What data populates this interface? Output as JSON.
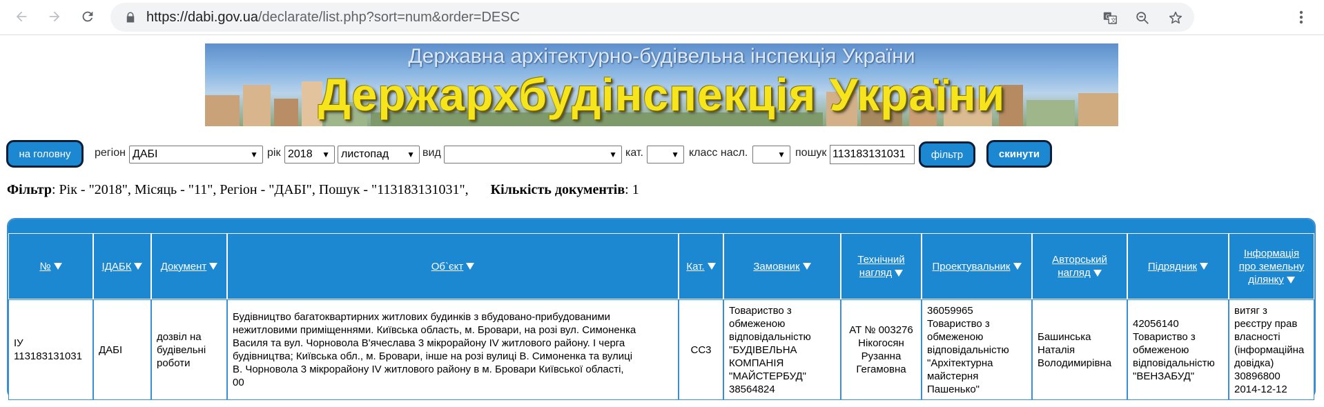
{
  "browser": {
    "url_host": "https://dabi.gov.ua",
    "url_path": "/declarate/list.php?sort=num&order=DESC"
  },
  "banner": {
    "subtitle": "Державна архітектурно-будівельна інспекція України",
    "title": "Держархбудінспекція України"
  },
  "filters": {
    "home_button": "на головну",
    "region_label": "регіон",
    "region_value": "ДАБІ",
    "year_label": "рік",
    "year_value": "2018",
    "month_value": "листопад",
    "type_label": "вид",
    "type_value": "",
    "cat_label": "кат.",
    "cat_value": "",
    "class_label": "класс насл.",
    "class_value": "",
    "search_label": "пошук",
    "search_value": "113183131031",
    "filter_button": "фільтр",
    "reset_button": "скинути"
  },
  "summary": {
    "filter_label": "Фільтр",
    "filter_text": ": Рік - \"2018\", Місяць - \"11\", Регіон - \"ДАБІ\", Пошук - \"113183131031\",",
    "count_label": "Кількість документів",
    "count_value": ": 1"
  },
  "table": {
    "headers": [
      {
        "line1": "№",
        "line2": ""
      },
      {
        "line1": "ІДАБК",
        "line2": ""
      },
      {
        "line1": "Документ",
        "line2": ""
      },
      {
        "line1": "Об`єкт",
        "line2": ""
      },
      {
        "line1": "Кат.",
        "line2": ""
      },
      {
        "line1": "Замовник",
        "line2": ""
      },
      {
        "line1": "Технічний",
        "line2": "нагляд"
      },
      {
        "line1": "Проектувальник",
        "line2": ""
      },
      {
        "line1": "Авторський",
        "line2": "нагляд"
      },
      {
        "line1": "Підрядник",
        "line2": ""
      },
      {
        "line1": "Інформація",
        "line2": "про земельну",
        "line3": "ділянку"
      }
    ],
    "row": {
      "num_1": "ІУ",
      "num_2": "113183131031",
      "idabk": "ДАБІ",
      "document_1": "дозвіл на",
      "document_2": "будівельні",
      "document_3": "роботи",
      "object_1": "Будівництво багатоквартирних житлових будинків з вбудовано-прибудованими",
      "object_2": "нежитловими приміщеннями. Київська область, м. Бровари, на розі вул. Симоненка",
      "object_3": "Василя та вул. Чорновола В'ячеслава 3 мікрорайону IV житлового району. І черга",
      "object_4": "будівництва; Київська обл., м. Бровари, інше на розі вулиці В. Симоненка та вулиці",
      "object_5": "В. Чорновола 3 мікрорайону IV житлового району в м. Бровари Київської області,",
      "object_6": "00",
      "category": "СС3",
      "customer_1": "Товариство з",
      "customer_2": "обмеженою",
      "customer_3": "відповідальністю",
      "customer_4": "\"БУДІВЕЛЬНА",
      "customer_5": "КОМПАНІЯ",
      "customer_6": "\"МАЙСТЕРБУД\"",
      "customer_7": "38564824",
      "tech_1": "АТ № 003276",
      "tech_2": "Нікогосян",
      "tech_3": "Рузанна",
      "tech_4": "Гегамовна",
      "designer_1": "36059965",
      "designer_2": "Товариство з",
      "designer_3": "обмеженою",
      "designer_4": "відповідальністю",
      "designer_5": "\"Архітектурна",
      "designer_6": "майстерня",
      "designer_7": "Пашенько\"",
      "author_1": "Башинська",
      "author_2": "Наталія",
      "author_3": "Володимирівна",
      "contractor_1": "42056140",
      "contractor_2": "Товариство з",
      "contractor_3": "обмеженою",
      "contractor_4": "відповідальністю",
      "contractor_5": "\"ВЕНЗАБУД\"",
      "land_1": "витяг з",
      "land_2": "реєстру прав",
      "land_3": "власності",
      "land_4": "(інформаційна",
      "land_5": "довідка)",
      "land_6": "30896800",
      "land_7": "2014-12-12"
    }
  },
  "colors": {
    "accent_blue": "#1b88d1",
    "banner_title": "#f6e41c"
  }
}
